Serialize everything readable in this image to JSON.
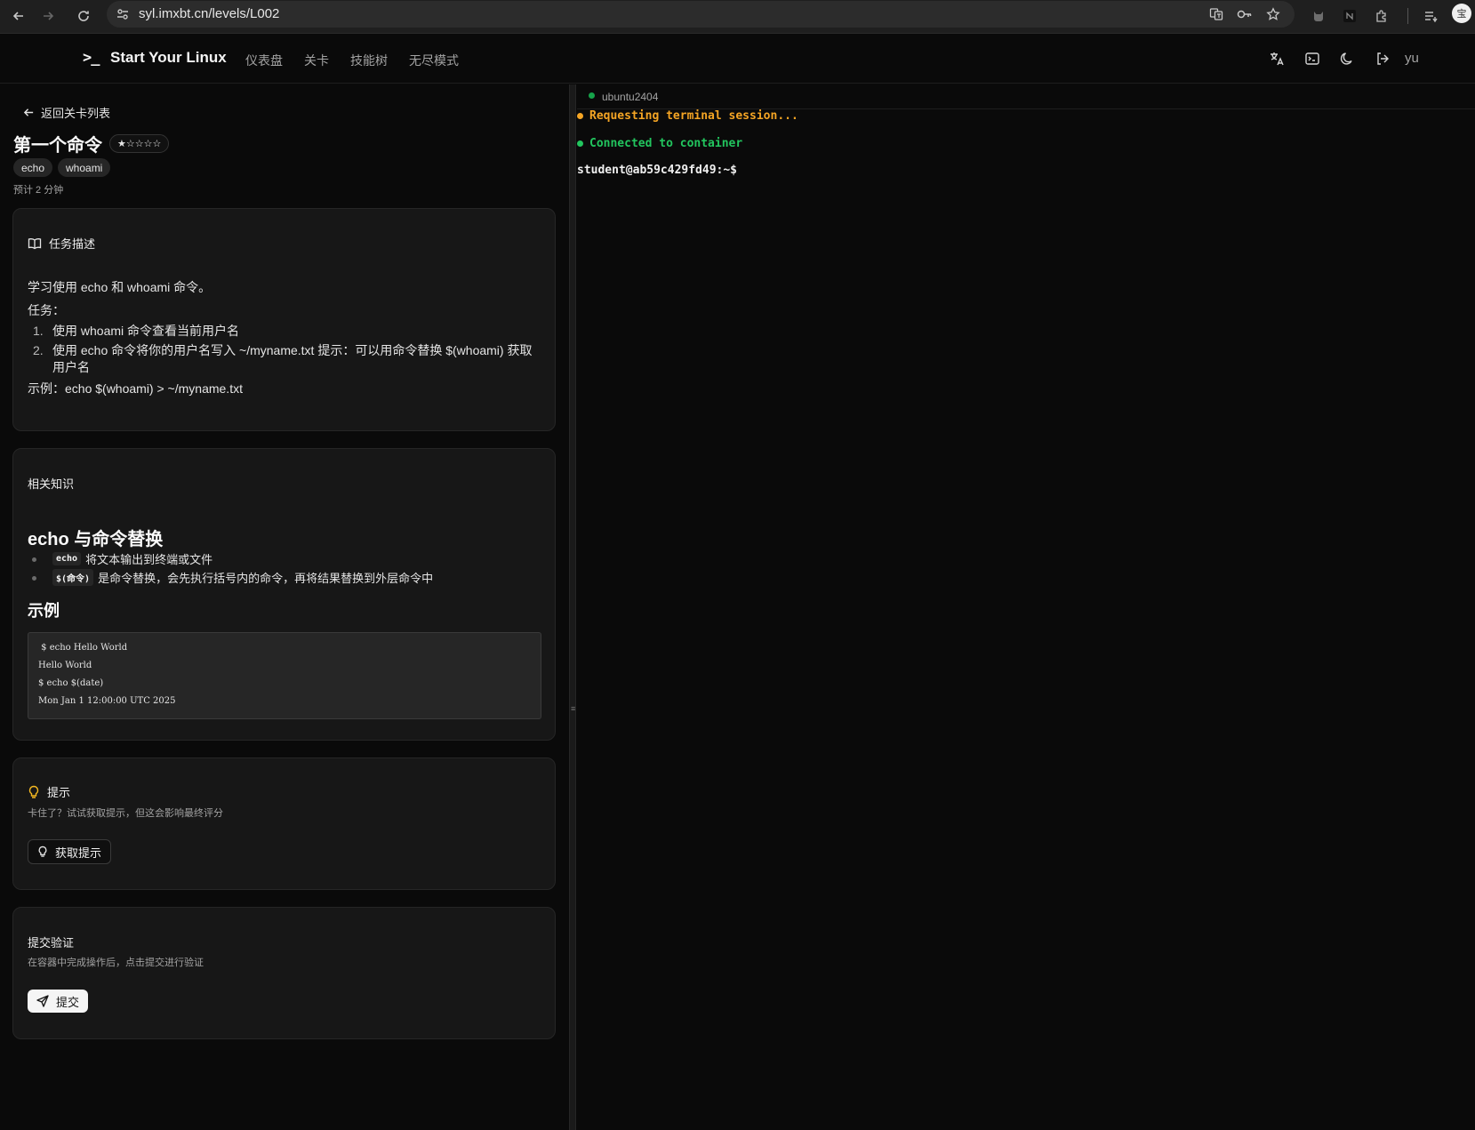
{
  "browser": {
    "url": "syl.imxbt.cn/levels/L002",
    "profile_initial": "宝"
  },
  "header": {
    "logo_mark": ">_",
    "app_name": "Start Your Linux",
    "nav": [
      "仪表盘",
      "关卡",
      "技能树",
      "无尽模式"
    ],
    "user": "yu"
  },
  "level": {
    "back_label": "返回关卡列表",
    "title": "第一个命令",
    "difficulty": "★☆☆☆☆",
    "tags": [
      "echo",
      "whoami"
    ],
    "estimated_time": "预计 2 分钟"
  },
  "task": {
    "heading": "任务描述",
    "intro": "学习使用 echo 和 whoami 命令。",
    "label": "任务：",
    "steps": [
      "使用 whoami 命令查看当前用户名",
      "使用 echo 命令将你的用户名写入 ~/myname.txt 提示：可以用命令替换 $(whoami) 获取用户名"
    ],
    "example": "示例：echo $(whoami) > ~/myname.txt"
  },
  "knowledge": {
    "heading": "相关知识",
    "section_title": "echo 与命令替换",
    "bullets": [
      {
        "code": "echo",
        "text": "将文本输出到终端或文件"
      },
      {
        "code": "$(命令)",
        "text": "是命令替换，会先执行括号内的命令，再将结果替换到外层命令中"
      }
    ],
    "example_title": "示例",
    "code_lines": [
      " $ echo Hello World",
      "Hello World",
      "$ echo $(date)",
      "Mon Jan 1 12:00:00 UTC 2025"
    ]
  },
  "hint": {
    "heading": "提示",
    "desc": "卡住了？试试获取提示，但这会影响最终评分",
    "button": "获取提示"
  },
  "submit": {
    "heading": "提交验证",
    "desc": "在容器中完成操作后，点击提交进行验证",
    "button": "提交"
  },
  "terminal": {
    "tab_label": "ubuntu2404",
    "lines": [
      {
        "text": "Requesting terminal session...",
        "color": "#f5a524"
      },
      {
        "text": "Connected to container",
        "color": "#22c55e"
      }
    ],
    "prompt": "student@ab59c429fd49:~$"
  },
  "colors": {
    "status_green": "#16a34a",
    "warning_amber": "#f5a524",
    "hint_bulb": "#f5b921"
  }
}
